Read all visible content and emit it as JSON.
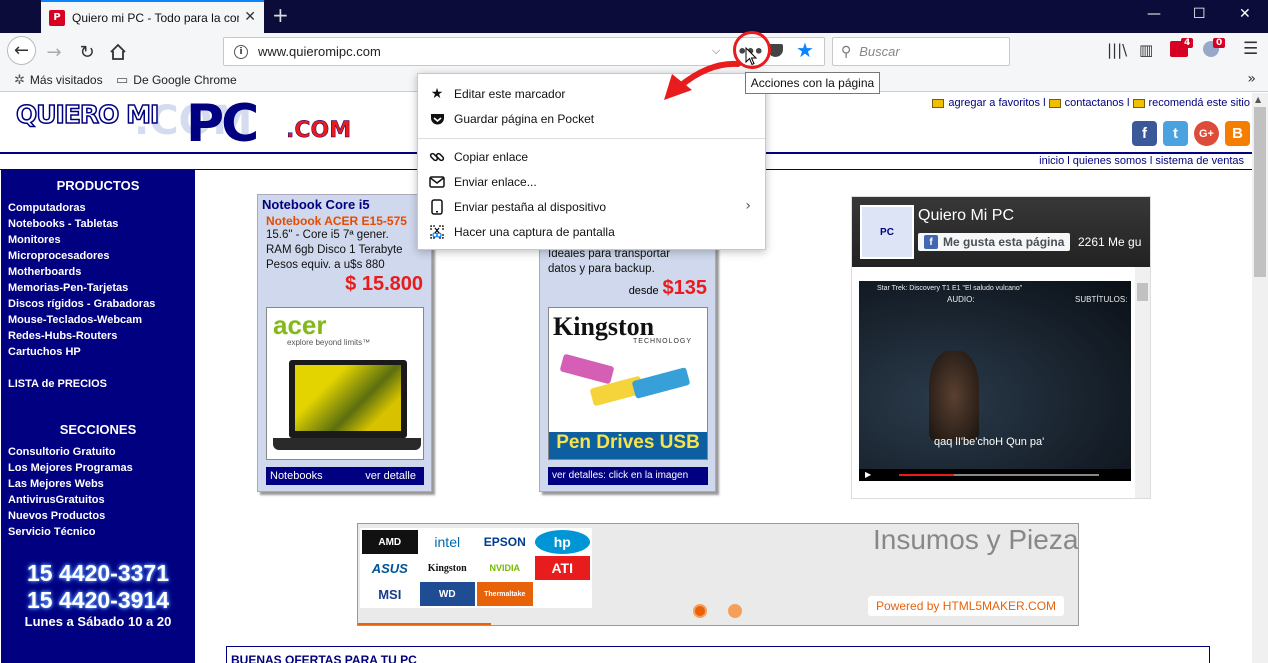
{
  "browser": {
    "tab_title": "Quiero mi PC - Todo para la computadora",
    "tab_favicon": "P",
    "tab_close": "✕",
    "new_tab": "+",
    "win_min": "—",
    "win_max": "☐",
    "win_close": "✕",
    "url": "www.quieromipc.com",
    "url_info": "i",
    "page_actions_label": "•••",
    "search_placeholder": "Buscar",
    "badge_1": "4",
    "badge_2": "0",
    "tooltip": "Acciones con la página",
    "accent_color": "#0a84ff"
  },
  "bookmarks": [
    {
      "label": "Más visitados"
    },
    {
      "label": "De Google Chrome"
    }
  ],
  "page_actions_menu": {
    "items": [
      {
        "label": "Editar este marcador",
        "icon": "star-icon"
      },
      {
        "label": "Guardar página en Pocket",
        "icon": "pocket-icon"
      },
      {
        "label": "Copiar enlace",
        "icon": "link-icon"
      },
      {
        "label": "Enviar enlace...",
        "icon": "mail-icon"
      },
      {
        "label": "Enviar pestaña al dispositivo",
        "icon": "device-icon"
      },
      {
        "label": "Hacer una captura de pantalla",
        "icon": "screenshot-icon"
      }
    ]
  },
  "site": {
    "logo_a": "QUIERO MI",
    "logo_b": "PC",
    "logo_c": ".COM",
    "top_links": [
      "agregar a favoritos",
      "contactanos",
      "recomendá este sitio"
    ],
    "socials": [
      "f",
      "t",
      "G+",
      "B"
    ],
    "nav_links": "inicio l quienes somos l sistema de ventas",
    "sidebar": {
      "products_title": "PRODUCTOS",
      "products": [
        "Computadoras",
        "Notebooks - Tabletas",
        "Monitores",
        "Microprocesadores",
        "Motherboards",
        "Memorias-Pen-Tarjetas",
        "Discos rígidos - Grabadoras",
        "Mouse-Teclados-Webcam",
        "Redes-Hubs-Routers",
        "Cartuchos HP"
      ],
      "price_list": "LISTA de PRECIOS",
      "sections_title": "SECCIONES",
      "sections": [
        "Consultorio Gratuito",
        "Los Mejores Programas",
        "Las Mejores Webs",
        "AntivirusGratuitos",
        "Nuevos Productos",
        "Servicio Técnico"
      ],
      "phone_1": "15 4420-3371",
      "phone_2": "15 4420-3914",
      "hours": "Lunes a Sábado 10 a 20"
    },
    "card_notebook": {
      "title": "Notebook Core i5",
      "model": "Notebook ACER E15-575",
      "spec_1": "15.6\" - Core i5 7ª gener.",
      "spec_2": "RAM 6gb Disco 1 Terabyte",
      "spec_3": "Pesos equiv. a u$s 880",
      "price": "$ 15.800",
      "brand": "acer",
      "tagline": "explore beyond limits™",
      "foot_left": "Notebooks",
      "foot_right": "ver detalle"
    },
    "card_pendrive": {
      "spec_1": "Ideales para transportar",
      "spec_2": "datos y para backup.",
      "desde": "desde",
      "price": "$135",
      "brand": "Kingston",
      "brand_sub": "TECHNOLOGY",
      "promo": "Pen Drives USB",
      "foot": "ver detalles: click en la imagen"
    },
    "facebook": {
      "page_name": "Quiero Mi PC",
      "like_label": "Me gusta esta página",
      "like_count": "2261 Me gu",
      "fb_icon": "f",
      "thumb_text": "PC",
      "video_sub": "qaq lI'be'choH Qun pa'",
      "video_label_1": "Star Trek: Discovery  T1 E1 \"El saludo vulcano\"",
      "video_label_audio": "AUDIO:",
      "video_label_subs": "SUBTÍTULOS:"
    },
    "banner": {
      "brands": [
        "AMD",
        "intel",
        "EPSON",
        "hp",
        "ASUS",
        "Kingston",
        "NVIDIA",
        "ATI",
        "MSI",
        "WD",
        "Thermaltake",
        ""
      ],
      "title": "Insumos y Piezas",
      "powered": "Powered by HTML5MAKER.COM"
    },
    "offers_title": "BUENAS OFERTAS PARA TU PC"
  }
}
